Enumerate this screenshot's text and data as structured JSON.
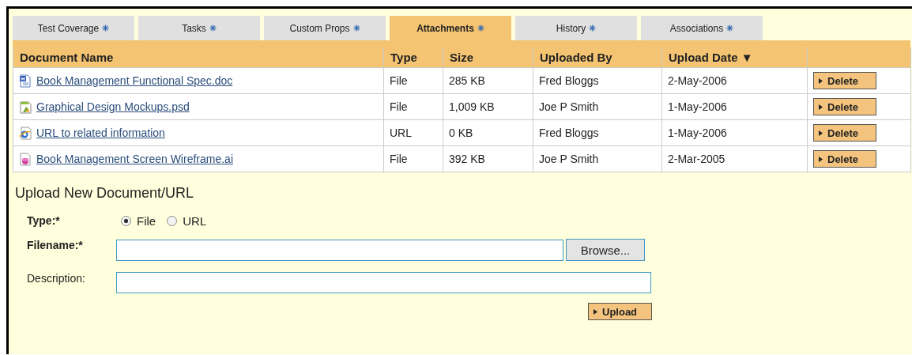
{
  "tabs": [
    {
      "label": "Test Coverage",
      "selected": false
    },
    {
      "label": "Tasks",
      "selected": false
    },
    {
      "label": "Custom Props",
      "selected": false
    },
    {
      "label": "Attachments",
      "selected": true
    },
    {
      "label": "History",
      "selected": false
    },
    {
      "label": "Associations",
      "selected": false
    }
  ],
  "table": {
    "columns": [
      {
        "label": "Document Name"
      },
      {
        "label": "Type"
      },
      {
        "label": "Size"
      },
      {
        "label": "Uploaded By"
      },
      {
        "label": "Upload Date",
        "sort_mark": "▼"
      },
      {}
    ],
    "rows": [
      {
        "kind": "doc",
        "name": "Book Management Functional Spec.doc",
        "type": "File",
        "size": "285 KB",
        "uploaded_by": "Fred Bloggs",
        "date": "2-May-2006",
        "action": "Delete"
      },
      {
        "kind": "image",
        "name": "Graphical Design Mockups.psd",
        "type": "File",
        "size": "1,009 KB",
        "uploaded_by": "Joe P Smith",
        "date": "1-May-2006",
        "action": "Delete"
      },
      {
        "kind": "url",
        "name": "URL to related information",
        "type": "URL",
        "size": "0 KB",
        "uploaded_by": "Fred Bloggs",
        "date": "1-May-2006",
        "action": "Delete"
      },
      {
        "kind": "vector",
        "name": "Book Management Screen Wireframe.ai",
        "type": "File",
        "size": "392 KB",
        "uploaded_by": "Joe P Smith",
        "date": "2-Mar-2005",
        "action": "Delete"
      }
    ]
  },
  "upload_form": {
    "title": "Upload New Document/URL",
    "type_label": "Type:*",
    "type_options": [
      {
        "label": "File",
        "selected": true
      },
      {
        "label": "URL",
        "selected": false
      }
    ],
    "filename_label": "Filename:*",
    "browse_button": "Browse...",
    "description_label": "Description:",
    "upload_button": "Upload"
  }
}
